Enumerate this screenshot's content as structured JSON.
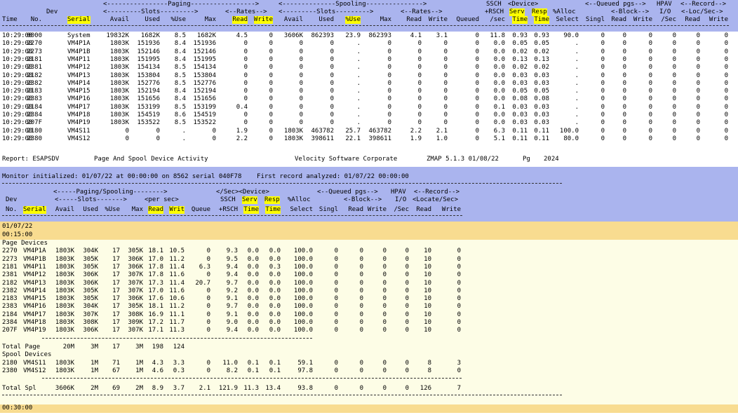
{
  "top": {
    "group_line": [
      "<----------------Paging----------------->",
      "<--------------Spooling--------------->",
      "SSCH",
      "<Device>",
      "<--Queued pgs-->",
      "HPAV",
      "<--Record-->"
    ],
    "sub_line": [
      "Dev",
      "<---------Slots--------->",
      "<--Rates-->",
      "<---------Slots--------->",
      "<--Rates-->",
      "+RSCH",
      "Serv",
      "Resp",
      "%Alloc",
      "<-Block-->",
      "I/O",
      "<-Loc/Sec->"
    ],
    "columns": [
      "Time",
      "No.",
      "Serial",
      "Avail",
      "Used",
      "%Use",
      "Max",
      "Read",
      "Write",
      "Avail",
      "Used",
      "%Use",
      "Max",
      "Read",
      "Write",
      "Queued",
      "/sec",
      "Time",
      "Time",
      "Select",
      "Singl",
      "Read",
      "Write",
      "/Sec",
      "Read",
      "Write"
    ],
    "rows": [
      [
        "10:29:00",
        "0000",
        "System",
        "19832K",
        "1682K",
        "8.5",
        "1682K",
        "4.5",
        "0",
        "3606K",
        "862393",
        "23.9",
        "862393",
        "4.1",
        "3.1",
        "0",
        "11.8",
        "0.93",
        "0.93",
        "90.0",
        "0",
        "0",
        "0",
        "0",
        "0",
        "0"
      ],
      [
        "10:29:00",
        "2270",
        "VM4P1A",
        "1803K",
        "151936",
        "8.4",
        "151936",
        "0",
        "0",
        "0",
        "0",
        ".",
        "0",
        "0",
        "0",
        "0",
        "0.0",
        "0.05",
        "0.05",
        ".",
        "0",
        "0",
        "0",
        "0",
        "0",
        "0"
      ],
      [
        "10:29:00",
        "2273",
        "VM4P1B",
        "1803K",
        "152146",
        "8.4",
        "152146",
        "0",
        "0",
        "0",
        "0",
        ".",
        "0",
        "0",
        "0",
        "0",
        "0.0",
        "0.02",
        "0.02",
        ".",
        "0",
        "0",
        "0",
        "0",
        "0",
        "0"
      ],
      [
        "10:29:00",
        "2181",
        "VM4P11",
        "1803K",
        "151995",
        "8.4",
        "151995",
        "0",
        "0",
        "0",
        "0",
        ".",
        "0",
        "0",
        "0",
        "0",
        "0.0",
        "0.13",
        "0.13",
        ".",
        "0",
        "0",
        "0",
        "0",
        "0",
        "0"
      ],
      [
        "10:29:00",
        "2381",
        "VM4P12",
        "1803K",
        "154134",
        "8.5",
        "154134",
        "0",
        "0",
        "0",
        "0",
        ".",
        "0",
        "0",
        "0",
        "0",
        "0.0",
        "0.02",
        "0.02",
        ".",
        "0",
        "0",
        "0",
        "0",
        "0",
        "0"
      ],
      [
        "10:29:00",
        "2182",
        "VM4P13",
        "1803K",
        "153804",
        "8.5",
        "153804",
        "0",
        "0",
        "0",
        "0",
        ".",
        "0",
        "0",
        "0",
        "0",
        "0.0",
        "0.03",
        "0.03",
        ".",
        "0",
        "0",
        "0",
        "0",
        "0",
        "0"
      ],
      [
        "10:29:00",
        "2382",
        "VM4P14",
        "1803K",
        "152776",
        "8.5",
        "152776",
        "0",
        "0",
        "0",
        "0",
        ".",
        "0",
        "0",
        "0",
        "0",
        "0.0",
        "0.03",
        "0.03",
        ".",
        "0",
        "0",
        "0",
        "0",
        "0",
        "0"
      ],
      [
        "10:29:00",
        "2183",
        "VM4P15",
        "1803K",
        "152194",
        "8.4",
        "152194",
        "0",
        "0",
        "0",
        "0",
        ".",
        "0",
        "0",
        "0",
        "0",
        "0.0",
        "0.05",
        "0.05",
        ".",
        "0",
        "0",
        "0",
        "0",
        "0",
        "0"
      ],
      [
        "10:29:00",
        "2383",
        "VM4P16",
        "1803K",
        "151656",
        "8.4",
        "151656",
        "0",
        "0",
        "0",
        "0",
        ".",
        "0",
        "0",
        "0",
        "0",
        "0.0",
        "0.08",
        "0.08",
        ".",
        "0",
        "0",
        "0",
        "0",
        "0",
        "0"
      ],
      [
        "10:29:00",
        "2184",
        "VM4P17",
        "1803K",
        "153199",
        "8.5",
        "153199",
        "0.4",
        "0",
        "0",
        "0",
        ".",
        "0",
        "0",
        "0",
        "0",
        "0.1",
        "0.03",
        "0.03",
        ".",
        "0",
        "0",
        "0",
        "0",
        "0",
        "0"
      ],
      [
        "10:29:00",
        "2384",
        "VM4P18",
        "1803K",
        "154519",
        "8.6",
        "154519",
        "0",
        "0",
        "0",
        "0",
        ".",
        "0",
        "0",
        "0",
        "0",
        "0.0",
        "0.03",
        "0.03",
        ".",
        "0",
        "0",
        "0",
        "0",
        "0",
        "0"
      ],
      [
        "10:29:00",
        "207F",
        "VM4P19",
        "1803K",
        "153522",
        "8.5",
        "153522",
        "0",
        "0",
        "0",
        "0",
        ".",
        "0",
        "0",
        "0",
        "0",
        "0.0",
        "0.03",
        "0.03",
        ".",
        "0",
        "0",
        "0",
        "0",
        "0",
        "0"
      ],
      [
        "10:29:00",
        "2180",
        "VM4S11",
        "0",
        "0",
        ".",
        "0",
        "1.9",
        "0",
        "1803K",
        "463782",
        "25.7",
        "463782",
        "2.2",
        "2.1",
        "0",
        "6.3",
        "0.11",
        "0.11",
        "100.0",
        "0",
        "0",
        "0",
        "0",
        "0",
        "0"
      ],
      [
        "10:29:00",
        "2380",
        "VM4S12",
        "0",
        "0",
        ".",
        "0",
        "2.2",
        "0",
        "1803K",
        "398611",
        "22.1",
        "398611",
        "1.9",
        "1.0",
        "0",
        "5.1",
        "0.11",
        "0.11",
        "80.0",
        "0",
        "0",
        "0",
        "0",
        "0",
        "0"
      ]
    ]
  },
  "report_line": {
    "report": "Report: ESAPSDV",
    "title": "Page And Spool Device Activity",
    "vendor": "Velocity Software Corporate",
    "product": "ZMAP 5.1.3 01/08/22",
    "pg_label": "Pg",
    "pg": "2024"
  },
  "monitor_line": "Monitor initialized: 01/07/22 at 00:00:00 on 8562 serial 040F78    First record analyzed: 01/07/22 00:00:00",
  "mid": {
    "group_line": [
      "<-----Paging/Spooling-------->",
      "</Sec><Device>",
      "<--Queued pgs-->",
      "HPAV",
      "<--Record-->"
    ],
    "sub_line": [
      "Dev",
      "<-----Slots------->",
      "<per sec>",
      "SSCH",
      "Serv",
      "Resp",
      "%Alloc",
      "<-Block-->",
      "I/O",
      "<Locate/Sec>"
    ],
    "columns": [
      "No.",
      "Serial",
      "Avail",
      "Used",
      "%Use",
      "Max",
      "Read",
      "Writ",
      "Queue",
      "+RSCH",
      "Time",
      "Time",
      "Select",
      "Singl",
      "Read",
      "Write",
      "/Sec",
      "Read",
      "Write"
    ],
    "date": "01/07/22",
    "time1": "00:15:00",
    "page_devices_label": "Page Devices",
    "page_rows": [
      [
        "2270",
        "VM4P1A",
        "1803K",
        "304K",
        "17",
        "305K",
        "18.1",
        "10.5",
        "0",
        "9.3",
        "0.0",
        "0.0",
        "100.0",
        "0",
        "0",
        "0",
        "0",
        "10",
        "0"
      ],
      [
        "2273",
        "VM4P1B",
        "1803K",
        "305K",
        "17",
        "306K",
        "17.0",
        "11.2",
        "0",
        "9.5",
        "0.0",
        "0.0",
        "100.0",
        "0",
        "0",
        "0",
        "0",
        "10",
        "0"
      ],
      [
        "2181",
        "VM4P11",
        "1803K",
        "305K",
        "17",
        "306K",
        "17.8",
        "11.4",
        "6.3",
        "9.4",
        "0.0",
        "0.3",
        "100.0",
        "0",
        "0",
        "0",
        "0",
        "10",
        "0"
      ],
      [
        "2381",
        "VM4P12",
        "1803K",
        "306K",
        "17",
        "307K",
        "17.8",
        "11.6",
        "0",
        "9.4",
        "0.0",
        "0.0",
        "100.0",
        "0",
        "0",
        "0",
        "0",
        "10",
        "0"
      ],
      [
        "2182",
        "VM4P13",
        "1803K",
        "306K",
        "17",
        "307K",
        "17.3",
        "11.4",
        "20.7",
        "9.7",
        "0.0",
        "0.0",
        "100.0",
        "0",
        "0",
        "0",
        "0",
        "10",
        "0"
      ],
      [
        "2382",
        "VM4P14",
        "1803K",
        "305K",
        "17",
        "307K",
        "17.0",
        "11.6",
        "0",
        "9.2",
        "0.0",
        "0.0",
        "100.0",
        "0",
        "0",
        "0",
        "0",
        "10",
        "0"
      ],
      [
        "2183",
        "VM4P15",
        "1803K",
        "305K",
        "17",
        "306K",
        "17.6",
        "10.6",
        "0",
        "9.1",
        "0.0",
        "0.0",
        "100.0",
        "0",
        "0",
        "0",
        "0",
        "10",
        "0"
      ],
      [
        "2383",
        "VM4P16",
        "1803K",
        "304K",
        "17",
        "305K",
        "18.1",
        "11.2",
        "0",
        "9.7",
        "0.0",
        "0.0",
        "100.0",
        "0",
        "0",
        "0",
        "0",
        "10",
        "0"
      ],
      [
        "2184",
        "VM4P17",
        "1803K",
        "307K",
        "17",
        "308K",
        "16.9",
        "11.1",
        "0",
        "9.1",
        "0.0",
        "0.0",
        "100.0",
        "0",
        "0",
        "0",
        "0",
        "10",
        "0"
      ],
      [
        "2384",
        "VM4P18",
        "1803K",
        "308K",
        "17",
        "309K",
        "17.2",
        "11.7",
        "0",
        "9.0",
        "0.0",
        "0.0",
        "100.0",
        "0",
        "0",
        "0",
        "0",
        "10",
        "0"
      ],
      [
        "207F",
        "VM4P19",
        "1803K",
        "306K",
        "17",
        "307K",
        "17.1",
        "11.3",
        "0",
        "9.4",
        "0.0",
        "0.0",
        "100.0",
        "0",
        "0",
        "0",
        "0",
        "10",
        "0"
      ]
    ],
    "total_page": [
      "Total Page",
      "20M",
      "3M",
      "17",
      "3M",
      "198",
      "124"
    ],
    "spool_devices_label": "Spool Devices",
    "spool_rows": [
      [
        "2180",
        "VM4S11",
        "1803K",
        "1M",
        "71",
        "1M",
        "4.3",
        "3.3",
        "0",
        "11.0",
        "0.1",
        "0.1",
        "59.1",
        "0",
        "0",
        "0",
        "0",
        "8",
        "3"
      ],
      [
        "2380",
        "VM4S12",
        "1803K",
        "1M",
        "67",
        "1M",
        "4.6",
        "0.3",
        "0",
        "8.2",
        "0.1",
        "0.1",
        "97.8",
        "0",
        "0",
        "0",
        "0",
        "8",
        "0"
      ]
    ],
    "total_spl": [
      "Total Spl",
      "3606K",
      "2M",
      "69",
      "2M",
      "8.9",
      "3.7",
      "2.1",
      "121.9",
      "11.3",
      "13.4",
      "93.8",
      "0",
      "0",
      "0",
      "0",
      "126",
      "7"
    ],
    "time2": "00:30:00"
  },
  "colors": {
    "header_blue": "#aab4ee",
    "data_cream": "#fdfde6",
    "time_gold": "#f8dc90",
    "highlight": "#ffff00"
  }
}
